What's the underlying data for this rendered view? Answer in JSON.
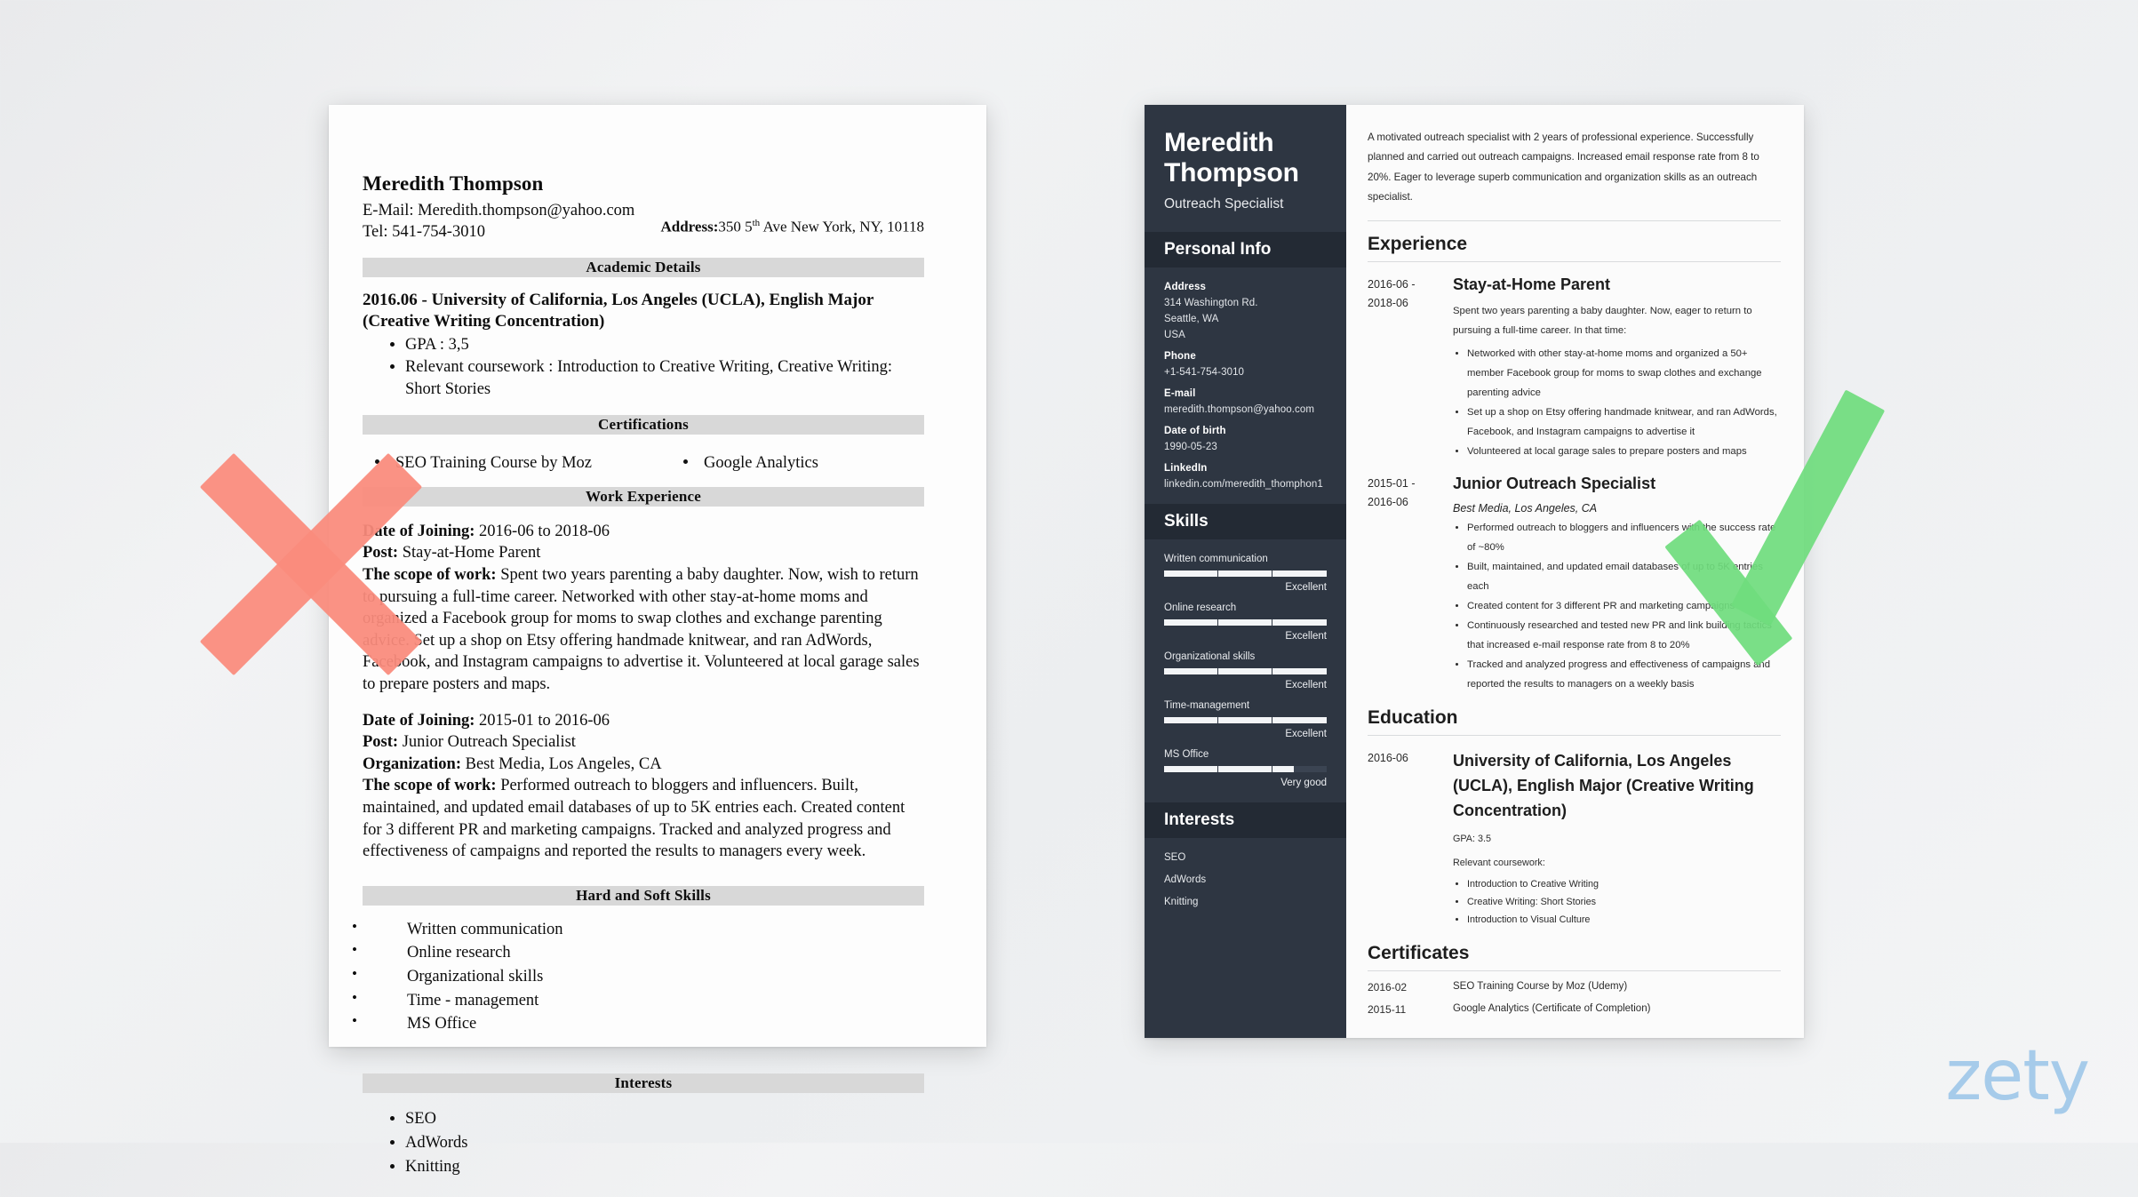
{
  "watermark": {
    "text": "zety",
    "color": "#a6cbea"
  },
  "marks": {
    "bad_color": "#fa8b7c",
    "good_color": "#6fdc7d",
    "bad_icon": "x-mark-icon",
    "good_icon": "check-mark-icon"
  },
  "bad_resume": {
    "name": "Meredith Thompson",
    "email_line": "E-Mail: Meredith.thompson@yahoo.com",
    "tel_line": "Tel: 541-754-3010",
    "address_label": "Address:",
    "address_value_pre": "350 5",
    "address_sup": "th",
    "address_value_post": " Ave New York, NY, 10118",
    "sections": {
      "academic": "Academic Details",
      "certifications": "Certifications",
      "work": "Work Experience",
      "skills": "Hard and Soft Skills",
      "interests": "Interests"
    },
    "education_head": "2016.06 - University of California, Los Angeles (UCLA), English Major (Creative Writing Concentration)",
    "education_bullets": [
      "GPA : 3,5",
      "Relevant coursework : Introduction to Creative Writing, Creative Writing: Short Stories"
    ],
    "certifications": [
      "SEO Training Course by Moz",
      "Google Analytics"
    ],
    "jobs": [
      {
        "date_label": "Date of Joining:",
        "date_value": " 2016-06 to 2018-06",
        "post_label": "Post:",
        "post_value": " Stay-at-Home Parent",
        "org_label": "",
        "org_value": "",
        "scope_label": "The scope of work:",
        "scope_value": " Spent two years parenting a baby daughter. Now, wish to return to pursuing a full-time career. Networked with other stay-at-home moms and organized a Facebook group for moms to swap clothes and exchange parenting advice. Set up a shop on Etsy offering handmade knitwear, and ran AdWords, Facebook, and Instagram campaigns to advertise it. Volunteered at local garage sales to prepare posters and maps."
      },
      {
        "date_label": "Date of Joining:",
        "date_value": " 2015-01 to 2016-06",
        "post_label": "Post:",
        "post_value": " Junior Outreach Specialist",
        "org_label": "Organization:",
        "org_value": " Best Media, Los Angeles, CA",
        "scope_label": "The scope of work:",
        "scope_value": " Performed outreach to bloggers and influencers. Built, maintained, and updated email databases of up to 5K entries each. Created content for 3 different PR and marketing campaigns. Tracked and analyzed progress and effectiveness of campaigns and reported the results to managers every week."
      }
    ],
    "skills": [
      "Written communication",
      "Online research",
      "Organizational skills",
      "Time - management",
      "MS Office"
    ],
    "interests": [
      "SEO",
      "AdWords",
      "Knitting"
    ]
  },
  "good_resume": {
    "sidebar": {
      "name": "Meredith Thompson",
      "job_title": "Outreach Specialist",
      "personal_info_heading": "Personal Info",
      "fields": [
        {
          "label": "Address",
          "values": [
            "314 Washington Rd.",
            "Seattle, WA",
            "USA"
          ]
        },
        {
          "label": "Phone",
          "values": [
            "+1-541-754-3010"
          ]
        },
        {
          "label": "E-mail",
          "values": [
            "meredith.thompson@yahoo.com"
          ]
        },
        {
          "label": "Date of birth",
          "values": [
            "1990-05-23"
          ]
        },
        {
          "label": "LinkedIn",
          "values": [
            "linkedin.com/meredith_thomphon1"
          ]
        }
      ],
      "skills_heading": "Skills",
      "skills": [
        {
          "name": "Written communication",
          "rating": "Excellent",
          "percent": 100
        },
        {
          "name": "Online research",
          "rating": "Excellent",
          "percent": 100
        },
        {
          "name": "Organizational skills",
          "rating": "Excellent",
          "percent": 100
        },
        {
          "name": "Time-management",
          "rating": "Excellent",
          "percent": 100
        },
        {
          "name": "MS Office",
          "rating": "Very good",
          "percent": 80
        }
      ],
      "interests_heading": "Interests",
      "interests": [
        "SEO",
        "AdWords",
        "Knitting"
      ]
    },
    "main": {
      "summary": "A motivated outreach specialist with 2 years of professional experience. Successfully planned and carried out outreach campaigns. Increased email response rate from 8 to 20%. Eager to leverage superb communication and organization skills as an outreach specialist.",
      "experience_heading": "Experience",
      "experience": [
        {
          "date_from": "2016-06 -",
          "date_to": "2018-06",
          "role": "Stay-at-Home Parent",
          "org": "",
          "desc": "Spent two years parenting a baby daughter. Now, eager to return to pursuing a full-time career. In that time:",
          "bullets": [
            "Networked with other stay-at-home moms and organized a 50+ member Facebook group for moms to swap clothes and exchange parenting advice",
            "Set up a shop on Etsy offering handmade knitwear, and ran AdWords, Facebook, and Instagram campaigns to advertise it",
            "Volunteered at local garage sales to prepare posters and maps"
          ]
        },
        {
          "date_from": "2015-01 -",
          "date_to": "2016-06",
          "role": "Junior Outreach Specialist",
          "org": "Best Media, Los Angeles, CA",
          "desc": "",
          "bullets": [
            "Performed outreach to bloggers and influencers with the success rate of ~80%",
            "Built, maintained, and updated email databases of up to 5K entries each",
            "Created content for 3 different PR and marketing campaigns",
            "Continuously researched and tested new PR and link building tactics that increased e-mail response rate from 8 to 20%",
            "Tracked and analyzed progress and effectiveness of campaigns and reported the results to managers on a weekly basis"
          ]
        }
      ],
      "education_heading": "Education",
      "education": {
        "date": "2016-06",
        "title": "University of California, Los Angeles (UCLA), English Major (Creative Writing Concentration)",
        "gpa": "GPA: 3.5",
        "coursework_label": "Relevant coursework:",
        "coursework": [
          "Introduction to Creative Writing",
          "Creative Writing: Short Stories",
          "Introduction to Visual Culture"
        ]
      },
      "certificates_heading": "Certificates",
      "certificates": [
        {
          "date": "2016-02",
          "title": "SEO Training Course by Moz (Udemy)"
        },
        {
          "date": "2015-11",
          "title": "Google Analytics (Certificate of Completion)"
        }
      ]
    }
  }
}
